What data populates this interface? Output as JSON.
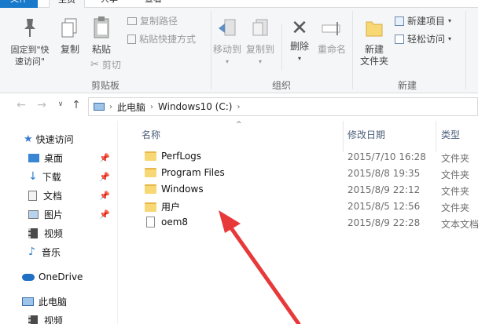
{
  "ribbon": {
    "tabs": [
      {
        "label": "文件",
        "x": 0
      },
      {
        "label": "主页"
      },
      {
        "label": "共享"
      },
      {
        "label": "查看"
      }
    ],
    "clipboard": {
      "pin_label": "固定到\"快速访问\"",
      "copy_label": "复制",
      "paste_label": "粘贴",
      "copy_path_label": "复制路径",
      "paste_shortcut_label": "粘贴快捷方式",
      "cut_label": "剪切",
      "group_label": "剪贴板"
    },
    "organize": {
      "move_to_label": "移动到",
      "copy_to_label": "复制到",
      "delete_label": "删除",
      "rename_label": "重命名",
      "group_label": "组织"
    },
    "new": {
      "new_folder_label": "新建\n文件夹",
      "new_item_label": "新建项目",
      "easy_access_label": "轻松访问",
      "group_label": "新建"
    }
  },
  "address": {
    "crumbs": [
      "此电脑",
      "Windows10 (C:)"
    ]
  },
  "nav": {
    "quick_access": "快速访问",
    "desktop": "桌面",
    "downloads": "下载",
    "documents": "文档",
    "pictures": "图片",
    "videos": "视频",
    "music": "音乐",
    "onedrive": "OneDrive",
    "this_pc": "此电脑",
    "videos2": "视频"
  },
  "columns": {
    "name": "名称",
    "date": "修改日期",
    "type": "类型"
  },
  "files": [
    {
      "name": "PerfLogs",
      "date": "2015/7/10 16:28",
      "type": "文件夹",
      "icon": "folder-icon"
    },
    {
      "name": "Program Files",
      "date": "2015/8/8 19:35",
      "type": "文件夹",
      "icon": "folder-icon"
    },
    {
      "name": "Windows",
      "date": "2015/8/9 22:12",
      "type": "文件夹",
      "icon": "folder-icon"
    },
    {
      "name": "用户",
      "date": "2015/8/5 12:56",
      "type": "文件夹",
      "icon": "folder-icon"
    },
    {
      "name": "oem8",
      "date": "2015/8/9 22:28",
      "type": "文本文档",
      "icon": "text-file-icon"
    }
  ],
  "colors": {
    "file_tab": "#1979ca",
    "annotation_arrow": "#e8393a",
    "folder": "#f8d775"
  }
}
